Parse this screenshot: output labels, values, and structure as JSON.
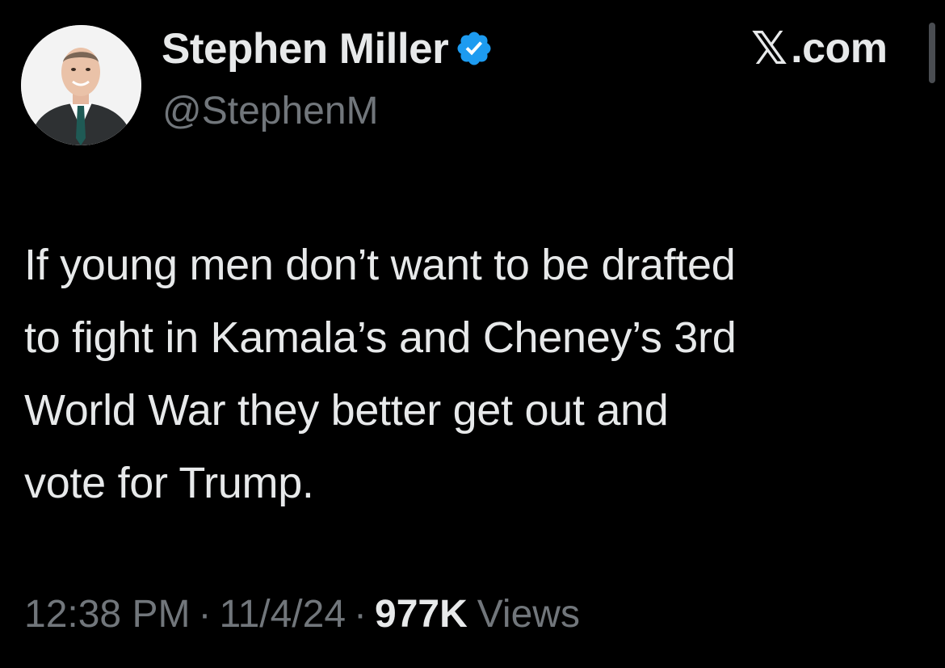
{
  "author": {
    "display_name": "Stephen Miller",
    "handle": "@StephenM",
    "verified": true,
    "verified_icon": "verified-badge-icon",
    "verified_color": "#1d9bf0"
  },
  "source": {
    "logo": "𝕏",
    "domain": ".com"
  },
  "tweet": {
    "lines": [
      "If young men don’t want to be drafted",
      "to fight in Kamala’s and Cheney’s 3rd",
      "World War they better get out and",
      "vote for Trump."
    ]
  },
  "meta": {
    "time": "12:38 PM",
    "separator": "·",
    "date": "11/4/24",
    "views_count": "977K",
    "views_label": "Views"
  },
  "colors": {
    "background": "#000000",
    "primary_text": "#e7e9ea",
    "secondary_text": "#71767b"
  }
}
